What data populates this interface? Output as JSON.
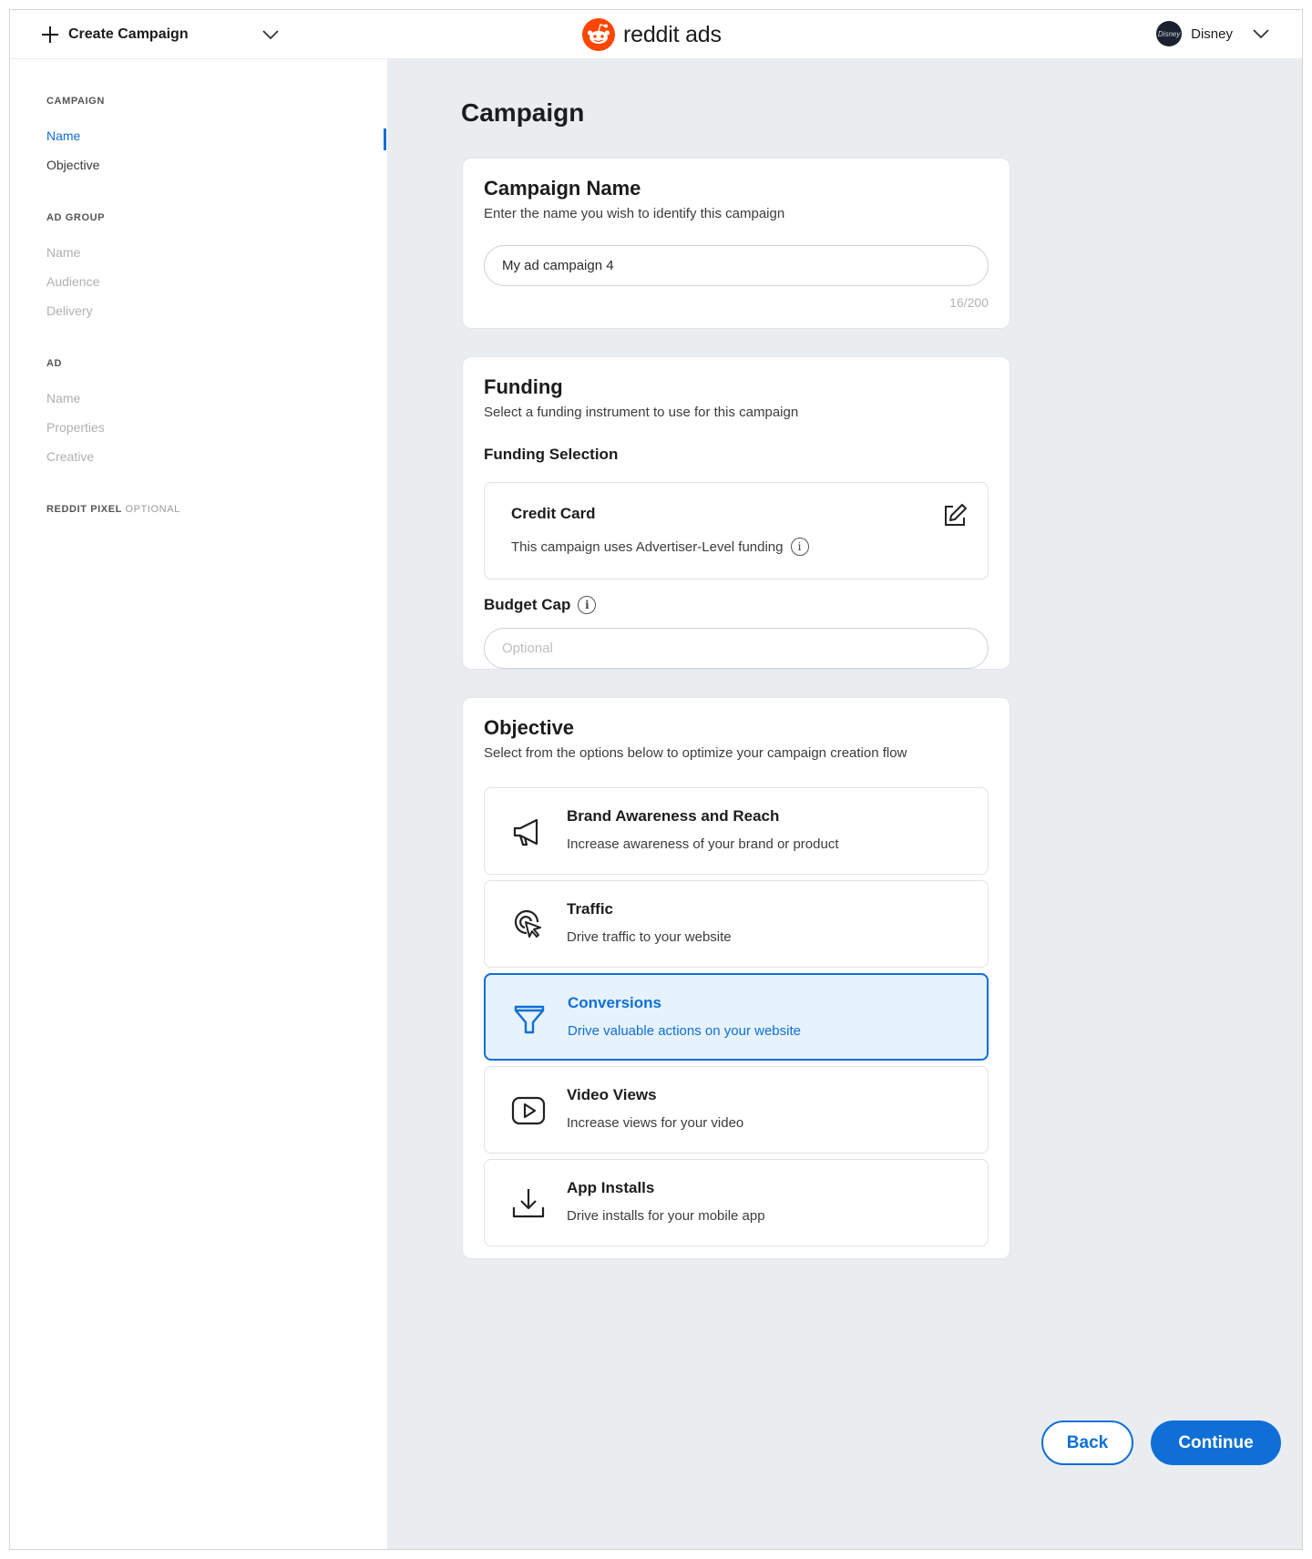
{
  "topbar": {
    "create_label": "Create Campaign",
    "brand": "reddit ads",
    "account_name": "Disney",
    "avatar_text": "Disney"
  },
  "sidebar": {
    "sections": [
      {
        "heading": "CAMPAIGN",
        "items": [
          "Name",
          "Objective"
        ]
      },
      {
        "heading": "AD GROUP",
        "items": [
          "Name",
          "Audience",
          "Delivery"
        ]
      },
      {
        "heading": "AD",
        "items": [
          "Name",
          "Properties",
          "Creative"
        ]
      },
      {
        "heading": "REDDIT PIXEL",
        "suffix": "OPTIONAL",
        "items": []
      }
    ]
  },
  "page": {
    "title": "Campaign"
  },
  "campaign_name": {
    "title": "Campaign Name",
    "subtitle": "Enter the name you wish to identify this campaign",
    "value": "My ad campaign 4",
    "counter": "16/200"
  },
  "funding": {
    "title": "Funding",
    "subtitle": "Select a funding instrument to use for this campaign",
    "selection_label": "Funding Selection",
    "method_title": "Credit Card",
    "method_desc": "This campaign uses Advertiser-Level funding",
    "budget_label": "Budget Cap",
    "budget_placeholder": "Optional"
  },
  "objective": {
    "title": "Objective",
    "subtitle": "Select from the options below to optimize your campaign creation flow",
    "options": [
      {
        "title": "Brand Awareness and Reach",
        "desc": "Increase awareness of your brand or product",
        "icon": "megaphone-icon",
        "selected": false
      },
      {
        "title": "Traffic",
        "desc": "Drive traffic to your website",
        "icon": "cursor-target-icon",
        "selected": false
      },
      {
        "title": "Conversions",
        "desc": "Drive valuable actions on your website",
        "icon": "funnel-icon",
        "selected": true
      },
      {
        "title": "Video Views",
        "desc": "Increase views for your video",
        "icon": "play-icon",
        "selected": false
      },
      {
        "title": "App Installs",
        "desc": "Drive installs for your mobile app",
        "icon": "download-icon",
        "selected": false
      }
    ]
  },
  "footer": {
    "back_label": "Back",
    "continue_label": "Continue"
  },
  "colors": {
    "accent": "#0f6fd6",
    "reddit_orange": "#ff4500",
    "main_bg": "#eaedf0",
    "selected_bg": "#e6f2fe"
  }
}
